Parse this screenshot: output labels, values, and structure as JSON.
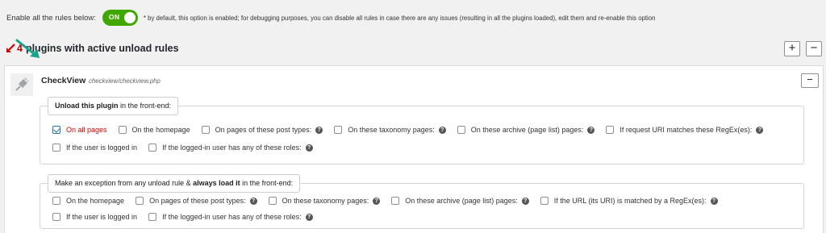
{
  "top": {
    "label": "Enable all the rules below:",
    "toggle_label": "ON",
    "note": "* by default, this option is enabled; for debugging purposes, you can disable all rules in case there are any issues (resulting in all the plugins loaded), edit them and re-enable this option"
  },
  "heading": {
    "count": "4",
    "text": "plugins with active unload rules"
  },
  "buttons": {
    "expand": "+",
    "collapse": "−",
    "plugin_collapse": "−"
  },
  "plugin": {
    "name": "CheckView",
    "path": "checkview/checkview.php"
  },
  "unload": {
    "legend_bold": "Unload this plugin",
    "legend_rest": " in the front-end:",
    "options_row1": [
      {
        "label": "On all pages",
        "checked": true,
        "help": false
      },
      {
        "label": "On the homepage",
        "checked": false,
        "help": false
      },
      {
        "label": "On pages of these post types:",
        "checked": false,
        "help": true
      },
      {
        "label": "On these taxonomy pages:",
        "checked": false,
        "help": true
      },
      {
        "label": "On these archive (page list) pages:",
        "checked": false,
        "help": true
      },
      {
        "label": "If request URI matches these RegEx(es):",
        "checked": false,
        "help": true
      }
    ],
    "options_row2": [
      {
        "label": "If the user is logged in",
        "checked": false,
        "help": false
      },
      {
        "label": "If the logged-in user has any of these roles:",
        "checked": false,
        "help": true
      }
    ]
  },
  "exception": {
    "legend_start": "Make an exception from any unload rule & ",
    "legend_bold": "always load it",
    "legend_end": " in the front-end:",
    "options_row1": [
      {
        "label": "On the homepage",
        "checked": false,
        "help": false
      },
      {
        "label": "On pages of these post types:",
        "checked": false,
        "help": true
      },
      {
        "label": "On these taxonomy pages:",
        "checked": false,
        "help": true
      },
      {
        "label": "On these archive (page list) pages:",
        "checked": false,
        "help": true
      },
      {
        "label": "If the URL (its URI) is matched by a RegEx(es):",
        "checked": false,
        "help": true
      }
    ],
    "options_row2": [
      {
        "label": "If the user is logged in",
        "checked": false,
        "help": false
      },
      {
        "label": "If the logged-in user has any of these roles:",
        "checked": false,
        "help": true
      }
    ]
  },
  "help_glyph": "?",
  "colors": {
    "toggle_on": "#3fa700",
    "active_rule": "#cc0000",
    "pointer_arrow": "#1aa38c"
  },
  "icons": {
    "plugin": "plug-icon",
    "heading": "unplug-arrow-icon",
    "pointer": "teal-arrow-icon"
  }
}
